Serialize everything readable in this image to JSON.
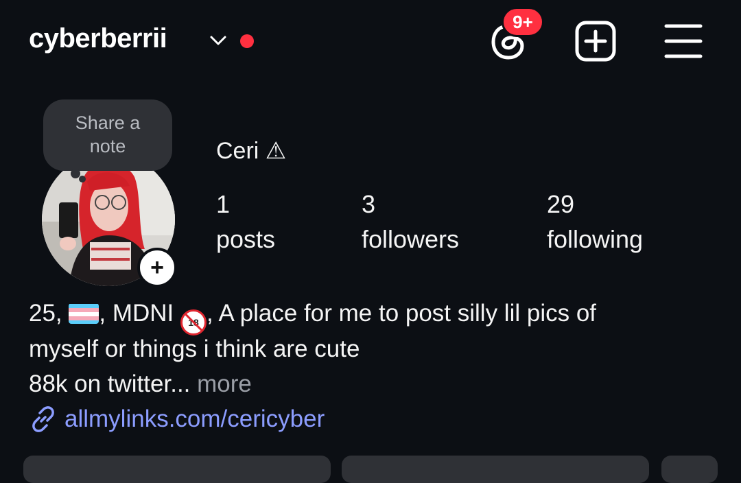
{
  "header": {
    "username": "cyberberrii",
    "notification_badge": "9+",
    "icons": {
      "switch_account": "chevron-down-icon",
      "threads": "threads-icon",
      "create": "plus-square-icon",
      "menu": "hamburger-menu-icon"
    },
    "accent_red": "#ff3040"
  },
  "note": {
    "placeholder": "Share a note"
  },
  "profile": {
    "display_name": "Ceri ⚠",
    "stats": [
      {
        "value": "1",
        "label": "posts"
      },
      {
        "value": "3",
        "label": "followers"
      },
      {
        "value": "29",
        "label": "following"
      }
    ]
  },
  "bio": {
    "line1_prefix": "25, ",
    "line1_middle": ", MDNI ",
    "line1_suffix": ", A place for me to post silly lil pics of",
    "line2": "myself or things i think are cute",
    "line3": "88k on twitter...",
    "more": "more",
    "link": "allmylinks.com/cericyber",
    "link_color": "#8c9dff",
    "emoji": [
      "transgender-flag-icon",
      "no-one-under-18-icon"
    ]
  }
}
